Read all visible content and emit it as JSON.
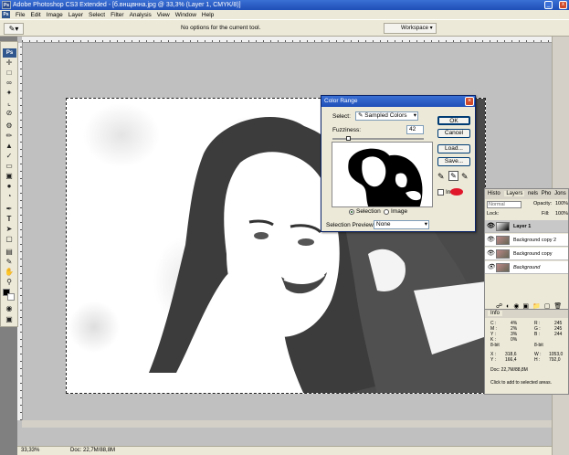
{
  "window": {
    "title": "Adobe Photoshop CS3 Extended - [б.внщвнна.jpg @ 33,3% (Layer 1, CMYK/8)]",
    "controls": [
      "_",
      "□",
      "x"
    ]
  },
  "menu": [
    "File",
    "Edit",
    "Image",
    "Layer",
    "Select",
    "Filter",
    "Analysis",
    "View",
    "Window",
    "Help"
  ],
  "options_bar": {
    "message": "No options for the current tool.",
    "workspace_label": "Workspace"
  },
  "toolbox": {
    "logo": "Ps",
    "tools": [
      "move-tool",
      "marquee-tool",
      "lasso-tool",
      "magic-wand-tool",
      "crop-tool",
      "slice-tool",
      "healing-tool",
      "brush-tool",
      "clone-stamp-tool",
      "history-brush-tool",
      "eraser-tool",
      "gradient-tool",
      "blur-tool",
      "dodge-tool",
      "pen-tool",
      "type-tool",
      "path-selection-tool",
      "shape-tool",
      "notes-tool",
      "eyedropper-tool",
      "hand-tool",
      "zoom-tool"
    ]
  },
  "status_bar": {
    "zoom": "33,33%",
    "doc": "Doc: 22,7M/88,8M"
  },
  "color_range": {
    "title": "Color Range",
    "select_label": "Select:",
    "select_value": "Sampled Colors",
    "fuzziness_label": "Fuzziness:",
    "fuzziness_value": "42",
    "ok": "OK",
    "cancel": "Cancel",
    "load": "Load...",
    "save": "Save...",
    "invert_label": "Invert",
    "radio_selection": "Selection",
    "radio_image": "Image",
    "preview_label": "Selection Preview:",
    "preview_value": "None"
  },
  "layers_panel": {
    "tabs": [
      "Histo",
      "Layers",
      "nels",
      "Pho",
      "Jons"
    ],
    "blend_mode": "Normal",
    "opacity_label": "Opacity:",
    "opacity_value": "100%",
    "lock_label": "Lock:",
    "fill_label": "Fill:",
    "fill_value": "100%",
    "layers": [
      "Layer 1",
      "Background copy 2",
      "Background copy",
      "Background"
    ]
  },
  "info_panel": {
    "tab": "Info",
    "left_col": [
      "C :",
      "M :",
      "Y :",
      "K :",
      "8-bit"
    ],
    "left_vals": [
      "4%",
      "2%",
      "3%",
      "0%",
      ""
    ],
    "right_col": [
      "R :",
      "G :",
      "B :",
      "8-bit"
    ],
    "right_vals": [
      "245",
      "245",
      "244",
      ""
    ],
    "xy": [
      "X :",
      "Y :"
    ],
    "xy_vals": [
      "318,6",
      "166,4"
    ],
    "wh": [
      "W :",
      "H :"
    ],
    "wh_vals": [
      "1053,0",
      "792,0"
    ],
    "doc": "Doc: 22,7M/88,8M",
    "hint": "Click to add to selected areas."
  }
}
